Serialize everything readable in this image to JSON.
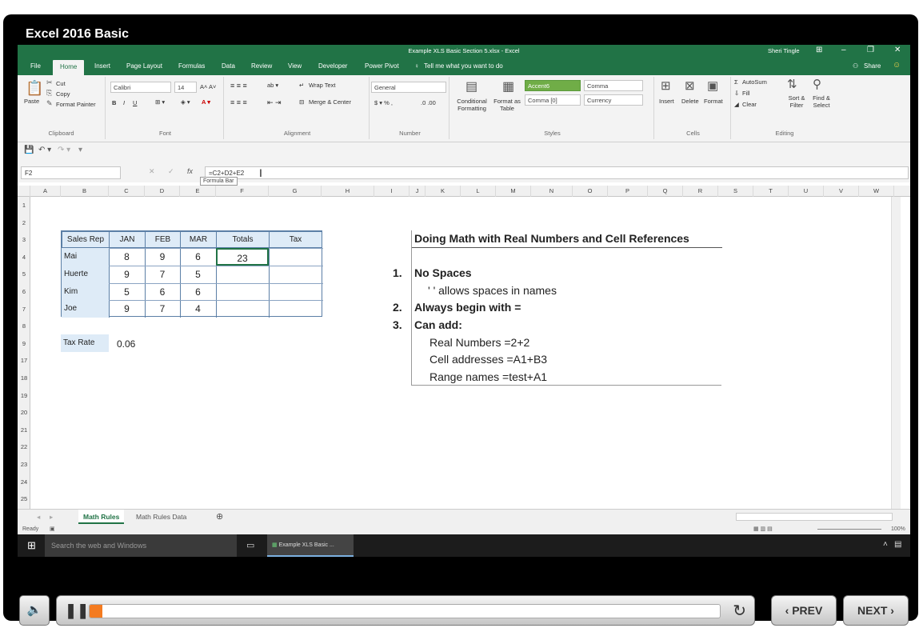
{
  "course": {
    "title": "Excel 2016 Basic"
  },
  "window": {
    "title": "Example XLS Basic Section 5.xlsx - Excel",
    "user": "Sheri Tingle"
  },
  "ribbon": {
    "tabs": [
      "File",
      "Home",
      "Insert",
      "Page Layout",
      "Formulas",
      "Data",
      "Review",
      "View",
      "Developer",
      "Power Pivot"
    ],
    "active_tab": "Home",
    "tell_me": "Tell me what you want to do",
    "share": "Share",
    "clipboard": {
      "paste": "Paste",
      "cut": "Cut",
      "copy": "Copy",
      "format_painter": "Format Painter",
      "label": "Clipboard"
    },
    "font": {
      "name": "Calibri",
      "size": "14",
      "label": "Font"
    },
    "alignment": {
      "wrap": "Wrap Text",
      "merge": "Merge & Center",
      "label": "Alignment"
    },
    "number": {
      "format": "General",
      "label": "Number"
    },
    "styles": {
      "conditional": "Conditional Formatting",
      "format_as_table": "Format as Table",
      "accent": "Accent6",
      "comma": "Comma",
      "comma0": "Comma [0]",
      "currency": "Currency",
      "label": "Styles"
    },
    "cells": {
      "insert": "Insert",
      "delete": "Delete",
      "format": "Format",
      "label": "Cells"
    },
    "editing": {
      "autosum": "AutoSum",
      "fill": "Fill",
      "clear": "Clear",
      "sort": "Sort & Filter",
      "find": "Find & Select",
      "label": "Editing"
    }
  },
  "formula_bar": {
    "name_box": "F2",
    "formula": "=C2+D2+E2",
    "tooltip": "Formula Bar"
  },
  "columns": [
    "A",
    "B",
    "C",
    "D",
    "E",
    "F",
    "G",
    "H",
    "I",
    "J",
    "K",
    "L",
    "M",
    "N",
    "O",
    "P",
    "Q",
    "R",
    "S",
    "T",
    "U",
    "V",
    "W"
  ],
  "rows": [
    "1",
    "2",
    "3",
    "4",
    "5",
    "6",
    "7",
    "8",
    "9",
    "17",
    "18",
    "19",
    "20",
    "21",
    "22",
    "23",
    "24",
    "25"
  ],
  "data_table": {
    "headers": [
      "Sales Rep",
      "JAN",
      "FEB",
      "MAR",
      "Totals",
      "Tax"
    ],
    "rows": [
      {
        "name": "Mai",
        "jan": "8",
        "feb": "9",
        "mar": "6",
        "total": "23"
      },
      {
        "name": "Huerte",
        "jan": "9",
        "feb": "7",
        "mar": "5",
        "total": ""
      },
      {
        "name": "Kim",
        "jan": "5",
        "feb": "6",
        "mar": "6",
        "total": ""
      },
      {
        "name": "Joe",
        "jan": "9",
        "feb": "7",
        "mar": "4",
        "total": ""
      }
    ]
  },
  "tax_rate": {
    "label": "Tax Rate",
    "value": "0.06"
  },
  "notes": {
    "title": "Doing Math with Real Numbers and Cell References",
    "items": [
      {
        "num": "1.",
        "text": "No Spaces"
      },
      {
        "sub": "' ' allows spaces in names"
      },
      {
        "num": "2.",
        "text": "Always begin with ="
      },
      {
        "num": "3.",
        "text": "Can add:"
      },
      {
        "sub": "Real Numbers =2+2"
      },
      {
        "sub": "Cell addresses =A1+B3"
      },
      {
        "sub": "Range names =test+A1"
      }
    ]
  },
  "sheets": [
    "Math Rules",
    "Math Rules Data"
  ],
  "status": {
    "ready": "Ready",
    "zoom": "100%"
  },
  "taskbar": {
    "search": "Search the web and Windows",
    "app": "Example XLS Basic ..."
  },
  "player": {
    "progress": 0.02,
    "prev": "PREV",
    "next": "NEXT"
  }
}
